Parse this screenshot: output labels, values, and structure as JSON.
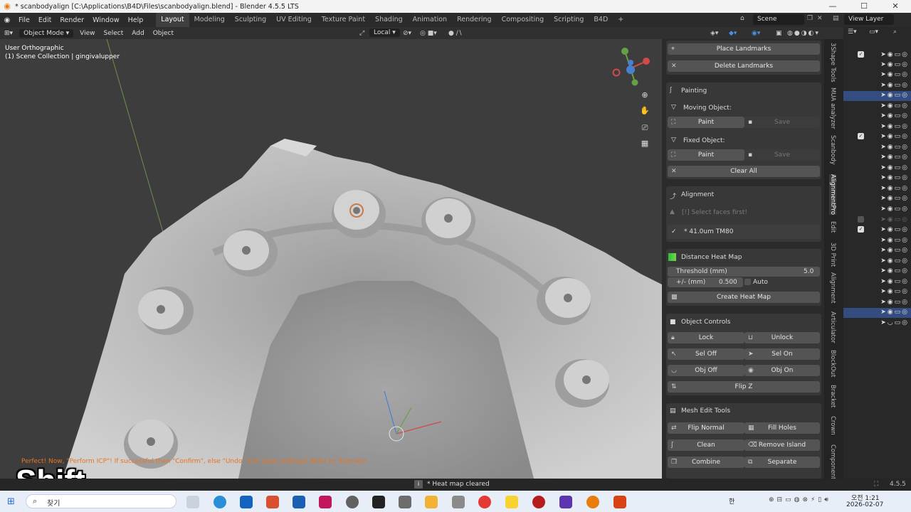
{
  "titlebar": {
    "title": "* scanbodyalign [C:\\Applications\\B4D\\Files\\scanbodyalign.blend] - Blender 4.5.5 LTS"
  },
  "menu": {
    "items": [
      "File",
      "Edit",
      "Render",
      "Window",
      "Help"
    ]
  },
  "workspaces": {
    "tabs": [
      "Layout",
      "Modeling",
      "Sculpting",
      "UV Editing",
      "Texture Paint",
      "Shading",
      "Animation",
      "Rendering",
      "Compositing",
      "Scripting",
      "B4D"
    ],
    "active": "Layout",
    "add": "+"
  },
  "scene": {
    "label": "Scene",
    "view_layer": "View Layer"
  },
  "header": {
    "mode": "Object Mode",
    "items": [
      "View",
      "Select",
      "Add",
      "Object"
    ],
    "transform": "Local"
  },
  "viewport": {
    "view_name": "User Orthographic",
    "collection": "(1) Scene Collection | gingivalupper",
    "info": "Perfect! Now, \"Perform ICP\"! If successful then \"Confirm\", else \"Undo\" and input settings! Refer to Tutorials!",
    "overlay_key": "Shift"
  },
  "panel": {
    "place_landmarks": "Place Landmarks",
    "delete_landmarks": "Delete Landmarks",
    "painting": {
      "title": "Painting",
      "moving": "Moving Object:",
      "fixed": "Fixed Object:",
      "paint": "Paint",
      "save": "Save",
      "clear_all": "Clear All"
    },
    "alignment": {
      "title": "Alignment",
      "warning": "[!] Select faces first!",
      "result": "* 41.0um TM80"
    },
    "heatmap": {
      "title": "Distance Heat Map",
      "threshold_label": "Threshold (mm)",
      "threshold_value": "5.0",
      "pm_label": "+/- (mm)",
      "pm_value": "0.500",
      "auto": "Auto",
      "create": "Create Heat Map"
    },
    "object_controls": {
      "title": "Object Controls",
      "lock": "Lock",
      "unlock": "Unlock",
      "sel_off": "Sel Off",
      "sel_on": "Sel On",
      "obj_off": "Obj Off",
      "obj_on": "Obj On",
      "flip_z": "Flip Z"
    },
    "mesh_edit": {
      "title": "Mesh Edit Tools",
      "flip_normal": "Flip Normal",
      "fill_holes": "Fill Holes",
      "clean": "Clean",
      "remove_island": "Remove Island",
      "combine": "Combine",
      "separate": "Separate"
    }
  },
  "side_tabs": [
    "3Shape Tools",
    "MUA analyzer",
    "Scanbody",
    "AlignmentPro",
    "Edit",
    "3D Print",
    "Alignment",
    "Articulator",
    "BlockOut",
    "Bracket",
    "Crown",
    "Component"
  ],
  "side_tab_active": "AlignmentPro",
  "status": {
    "message": "* Heat map cleared",
    "version": "4.5.5"
  },
  "taskbar": {
    "search": "찾기",
    "time": "오전 1:21",
    "date": "2026-02-07",
    "ime": "한"
  }
}
